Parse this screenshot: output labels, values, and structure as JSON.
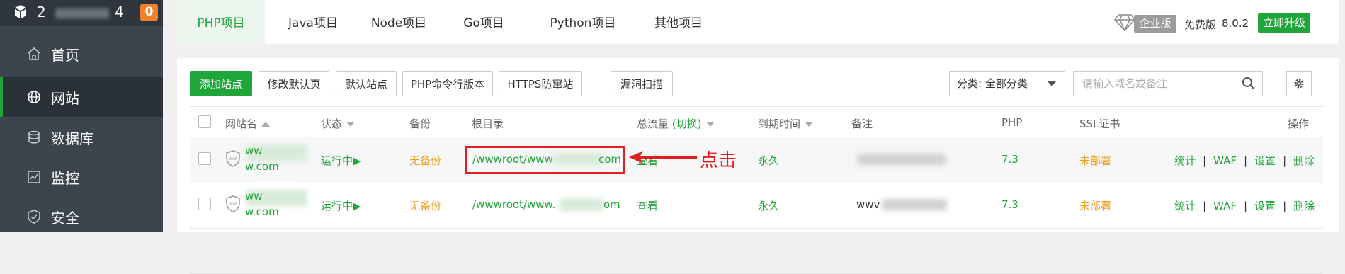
{
  "sidebar": {
    "server_name_start": "2",
    "server_name_end": "4",
    "badge": "0",
    "items": [
      {
        "label": "首页",
        "icon": "home-icon"
      },
      {
        "label": "网站",
        "icon": "globe-icon"
      },
      {
        "label": "数据库",
        "icon": "database-icon"
      },
      {
        "label": "监控",
        "icon": "monitor-icon"
      },
      {
        "label": "安全",
        "icon": "shield-icon"
      }
    ]
  },
  "tabs": [
    "PHP项目",
    "Java项目",
    "Node项目",
    "Go项目",
    "Python项目",
    "其他项目"
  ],
  "header_right": {
    "enterprise": "企业版",
    "free": "免费版",
    "version": "8.0.2",
    "upgrade": "立即升级"
  },
  "toolbar": {
    "add_site": "添加站点",
    "edit_default_page": "修改默认页",
    "default_site": "默认站点",
    "php_cli": "PHP命令行版本",
    "https_block": "HTTPS防窜站",
    "vuln_scan": "漏洞扫描",
    "category": "分类: 全部分类",
    "search_placeholder": "请输入域名或备注"
  },
  "table": {
    "headers": {
      "site": "网站名",
      "status": "状态",
      "backup": "备份",
      "root": "根目录",
      "traffic": "总流量",
      "traffic_switch": "(切换)",
      "expire": "到期时间",
      "remark": "备注",
      "php": "PHP",
      "ssl": "SSL证书",
      "ops": "操作"
    },
    "rows": [
      {
        "site_line1": "ww",
        "site_line2": "w.com",
        "status": "运行中▶",
        "backup": "无备份",
        "root_start": "/wwwroot/www",
        "root_end": "com",
        "traffic": "查看",
        "expire": "永久",
        "remark": "",
        "php": "7.3",
        "ssl": "未部署",
        "ops": [
          "统计",
          "WAF",
          "设置",
          "删除"
        ]
      },
      {
        "site_line1": "ww",
        "site_line2": "w.com",
        "status": "运行中▶",
        "backup": "无备份",
        "root_start": "/wwwroot/www.",
        "root_end": "om",
        "traffic": "查看",
        "expire": "永久",
        "remark": "wwv",
        "php": "7.3",
        "ssl": "未部署",
        "ops": [
          "统计",
          "WAF",
          "设置",
          "删除"
        ]
      }
    ]
  },
  "annotation": {
    "click_label": "点击",
    "color": "#e02020"
  },
  "colors": {
    "accent": "#20a53a",
    "warning": "#f0a020",
    "sidebar": "#3c444d"
  }
}
